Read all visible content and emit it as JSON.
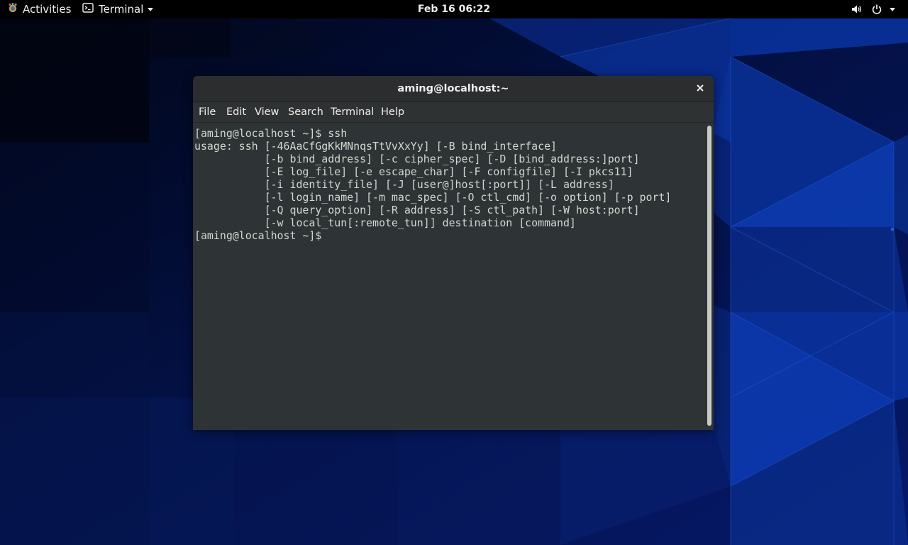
{
  "topbar": {
    "activities_label": "Activities",
    "app_menu_label": "Terminal",
    "clock": "Feb 16  06:22",
    "icons": {
      "activities": "gnome-foot-icon",
      "app": "terminal-icon",
      "volume": "volume-icon",
      "power": "power-icon",
      "menu": "chevron-down-icon"
    }
  },
  "window": {
    "title": "aming@localhost:~",
    "close_icon": "close-icon",
    "menu": {
      "file": "File",
      "edit": "Edit",
      "view": "View",
      "search": "Search",
      "terminal": "Terminal",
      "help": "Help"
    }
  },
  "terminal": {
    "lines": [
      "[aming@localhost ~]$ ssh",
      "usage: ssh [-46AaCfGgKkMNnqsTtVvXxYy] [-B bind_interface]",
      "           [-b bind_address] [-c cipher_spec] [-D [bind_address:]port]",
      "           [-E log_file] [-e escape_char] [-F configfile] [-I pkcs11]",
      "           [-i identity_file] [-J [user@]host[:port]] [-L address]",
      "           [-l login_name] [-m mac_spec] [-O ctl_cmd] [-o option] [-p port]",
      "           [-Q query_option] [-R address] [-S ctl_path] [-W host:port]",
      "           [-w local_tun[:remote_tun]] destination [command]",
      "[aming@localhost ~]$ "
    ]
  },
  "colors": {
    "topbar_bg": "#000000",
    "desktop_blue": "#06154e",
    "terminal_bg": "#2e3436",
    "terminal_fg": "#d3d7cf"
  }
}
